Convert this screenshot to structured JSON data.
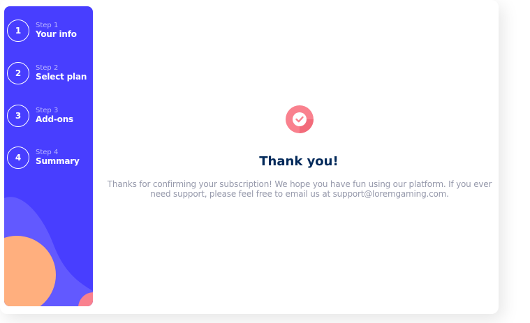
{
  "steps": [
    {
      "number": "1",
      "label": "Step 1",
      "title": "Your info"
    },
    {
      "number": "2",
      "label": "Step 2",
      "title": "Select plan"
    },
    {
      "number": "3",
      "label": "Step 3",
      "title": "Add-ons"
    },
    {
      "number": "4",
      "label": "Step 4",
      "title": "Summary"
    }
  ],
  "confirmation": {
    "icon": "checkmark-icon",
    "title": "Thank you!",
    "message": "Thanks for confirming your subscription! We hope you have fun using our platform. If you ever need support, please feel free to email us at support@loremgaming.com."
  },
  "colors": {
    "sidebar": "#483eff",
    "title": "#02295a",
    "text": "#9699ab",
    "check_circle": "#f9818e"
  }
}
